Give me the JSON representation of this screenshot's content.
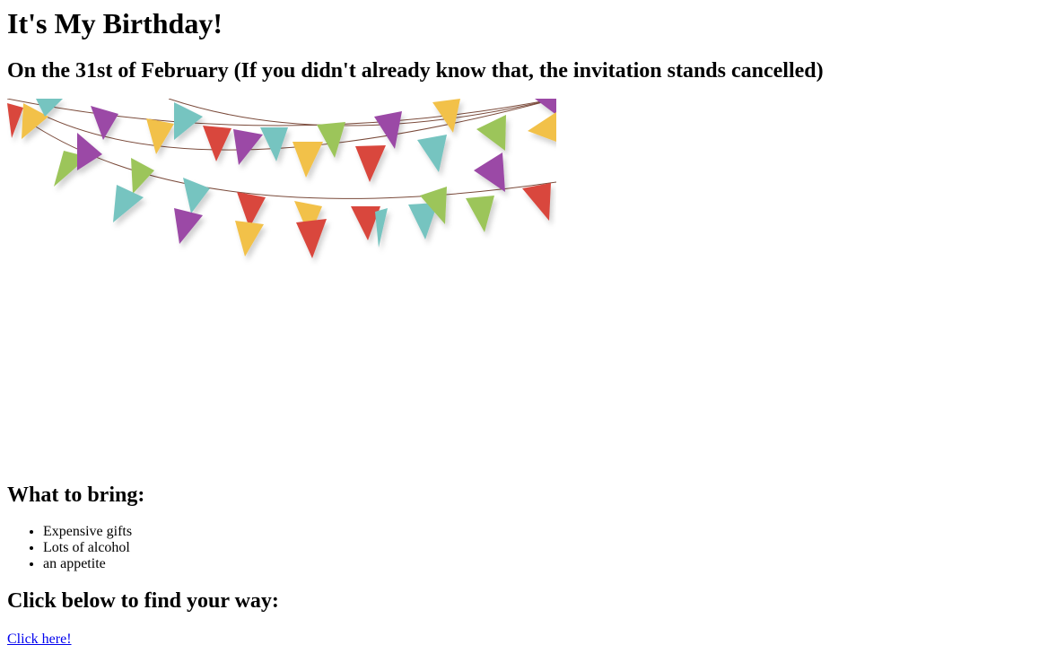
{
  "page": {
    "title": "It's My Birthday!",
    "subtitle": "On the 31st of February (If you didn't already know that, the invitation stands cancelled)"
  },
  "banner": {
    "icon": "bunting-garland-image",
    "colors": [
      "#d9463e",
      "#f2c14a",
      "#9b4aa6",
      "#76c4c0",
      "#9cc55a"
    ]
  },
  "bring": {
    "heading": "What to bring:",
    "items": [
      "Expensive gifts",
      "Lots of alcohol",
      "an appetite"
    ]
  },
  "directions": {
    "heading": "Click below to find your way:",
    "link_label": "Click here!"
  }
}
